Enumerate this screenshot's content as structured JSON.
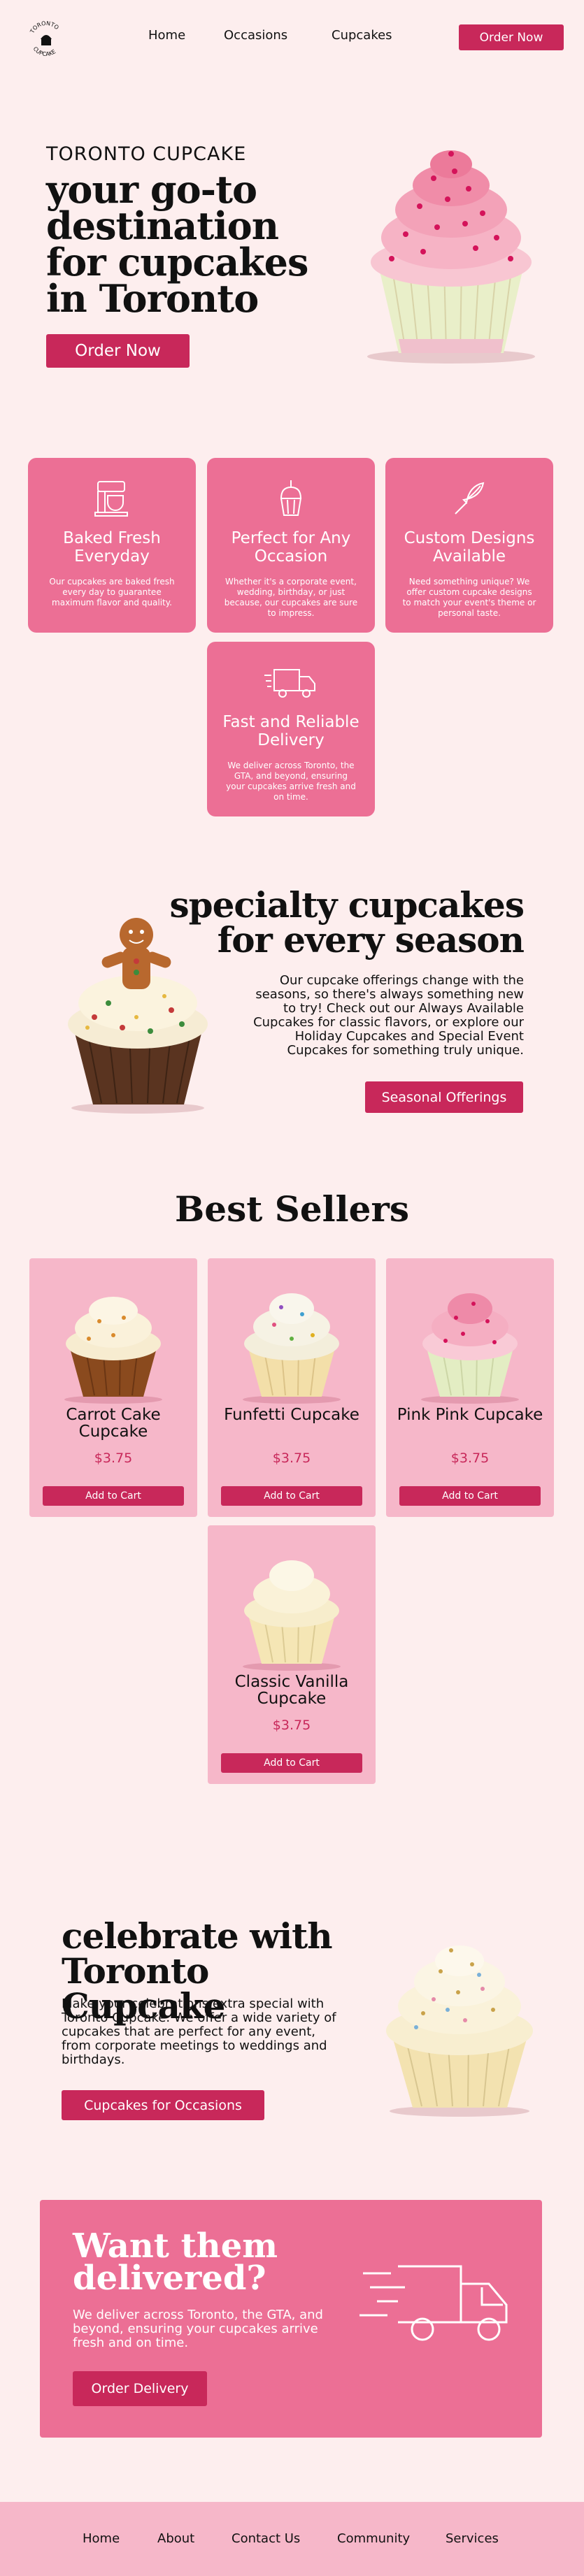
{
  "header": {
    "logo_text": "TORONTO CUPCAKE",
    "nav": [
      {
        "label": "Home"
      },
      {
        "label": "Occasions"
      },
      {
        "label": "Cupcakes"
      }
    ],
    "order_button": "Order Now"
  },
  "hero": {
    "brand": "TORONTO CUPCAKE",
    "title": "your go-to destination for cupcakes in Toronto",
    "button": "Order Now"
  },
  "features": [
    {
      "icon": "mixer-icon",
      "title": "Baked Fresh Everyday",
      "desc": "Our cupcakes are baked fresh every day to guarantee maximum flavor and quality."
    },
    {
      "icon": "cupcake-icon",
      "title": "Perfect for Any Occasion",
      "desc": "Whether it's a corporate event, wedding, birthday, or just because, our cupcakes are sure to impress."
    },
    {
      "icon": "whisk-icon",
      "title": "Custom Designs Available",
      "desc": "Need something unique? We offer custom cupcake designs to match your event's theme or personal taste."
    },
    {
      "icon": "delivery-truck-icon",
      "title": "Fast and Reliable Delivery",
      "desc": "We deliver across Toronto, the GTA, and beyond, ensuring your cupcakes arrive fresh and on time."
    }
  ],
  "specialty": {
    "title": "specialty cupcakes for every season",
    "text": "Our cupcake offerings change with the seasons, so there's always something new to try! Check out our Always Available Cupcakes for classic flavors, or explore our Holiday Cupcakes and Special Event Cupcakes for something truly unique.",
    "button": "Seasonal Offerings"
  },
  "best_sellers": {
    "title": "Best Sellers",
    "products": [
      {
        "name": "Carrot Cake Cupcake",
        "price": "$3.75",
        "button": "Add to Cart"
      },
      {
        "name": "Funfetti Cupcake",
        "price": "$3.75",
        "button": "Add to Cart"
      },
      {
        "name": "Pink Pink Cupcake",
        "price": "$3.75",
        "button": "Add to Cart"
      },
      {
        "name": "Classic Vanilla Cupcake",
        "price": "$3.75",
        "button": "Add to Cart"
      }
    ]
  },
  "celebrate": {
    "title": "celebrate with Toronto Cupcake",
    "text": "Make your celebrations extra special with Toronto Cupcake. We offer a wide variety of cupcakes that are perfect for any event, from corporate meetings to weddings and birthdays.",
    "button": "Cupcakes for Occasions"
  },
  "delivery": {
    "title": "Want them delivered?",
    "text": "We deliver across Toronto, the GTA, and beyond, ensuring your cupcakes arrive fresh and on time.",
    "button": "Order Delivery"
  },
  "footer": {
    "links": [
      {
        "label": "Home"
      },
      {
        "label": "About"
      },
      {
        "label": "Contact Us"
      },
      {
        "label": "Community"
      },
      {
        "label": "Services"
      }
    ]
  },
  "colors": {
    "background": "#fdeeee",
    "accent": "#c8285a",
    "card_pink": "#ec6f95",
    "light_pink": "#f6b7c9"
  }
}
